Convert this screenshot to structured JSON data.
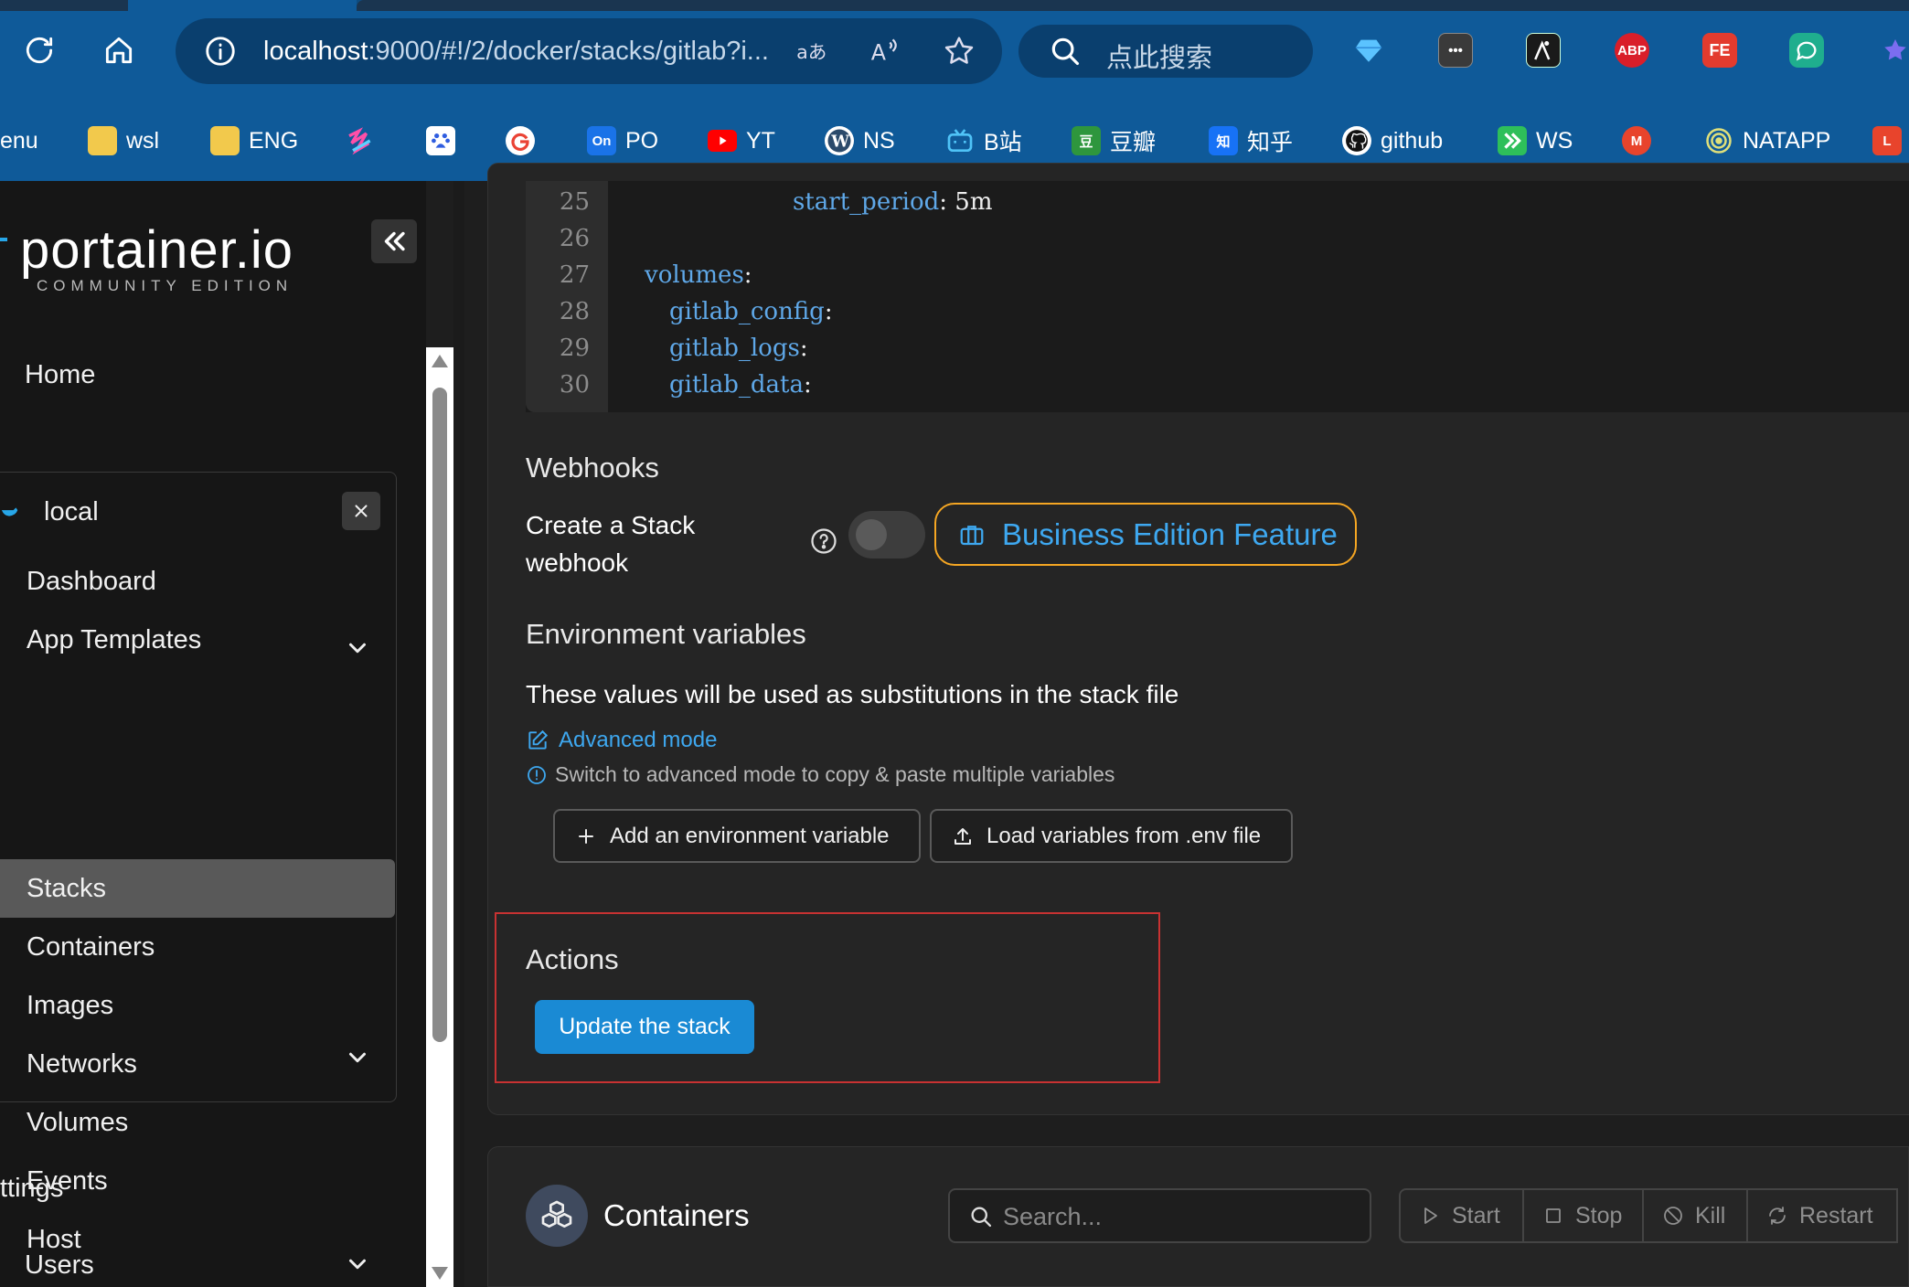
{
  "browser": {
    "url_host": "localhost",
    "url_rest": ":9000/#!/2/docker/stacks/gitlab?i...",
    "search_placeholder": "点此搜索",
    "extensions": [
      "ABP",
      "FE"
    ],
    "bookmarks": [
      "enu",
      "wsl",
      "ENG",
      "PO",
      "YT",
      "NS",
      "B站",
      "豆瓣",
      "知乎",
      "github",
      "WS",
      "NATAPP"
    ],
    "bookmark_icon_letters": {
      "on": "On",
      "douban": "豆",
      "zhihu": "知",
      "m": "M",
      "l": "L"
    }
  },
  "sidebar": {
    "logo": "portainer.io",
    "edition": "COMMUNITY EDITION",
    "home": "Home",
    "environment": "local",
    "items": [
      "Dashboard",
      "App Templates",
      "Stacks",
      "Containers",
      "Images",
      "Networks",
      "Volumes",
      "Events",
      "Host"
    ],
    "settings": "ttings",
    "users": "Users",
    "active_item": "Stacks"
  },
  "editor": {
    "lines": [
      {
        "n": "25",
        "indent": 6,
        "key": "start_period",
        "value": ": 5m"
      },
      {
        "n": "26",
        "indent": 0,
        "key": "",
        "value": ""
      },
      {
        "n": "27",
        "indent": 0,
        "key": "volumes",
        "value": ":"
      },
      {
        "n": "28",
        "indent": 1,
        "key": "gitlab_config",
        "value": ":"
      },
      {
        "n": "29",
        "indent": 1,
        "key": "gitlab_logs",
        "value": ":"
      },
      {
        "n": "30",
        "indent": 1,
        "key": "gitlab_data",
        "value": ":"
      }
    ]
  },
  "webhooks": {
    "title": "Webhooks",
    "label_line1": "Create a Stack",
    "label_line2": "webhook",
    "toggle_on": false,
    "be_feature": "Business Edition Feature"
  },
  "env_vars": {
    "title": "Environment variables",
    "description": "These values will be used as substitutions in the stack file",
    "advanced_mode": "Advanced mode",
    "hint": "Switch to advanced mode to copy & paste multiple variables",
    "add_button": "Add an environment variable",
    "load_button": "Load variables from .env file"
  },
  "actions": {
    "title": "Actions",
    "update_button": "Update the stack"
  },
  "containers": {
    "title": "Containers",
    "search_placeholder": "Search...",
    "buttons": [
      "Start",
      "Stop",
      "Kill",
      "Restart"
    ]
  },
  "colors": {
    "browser_blue": "#0f5a99",
    "primary_button": "#1a8ad4",
    "be_border": "#f5a623",
    "link_blue": "#3ea8f0",
    "highlight_red": "#c83232"
  }
}
